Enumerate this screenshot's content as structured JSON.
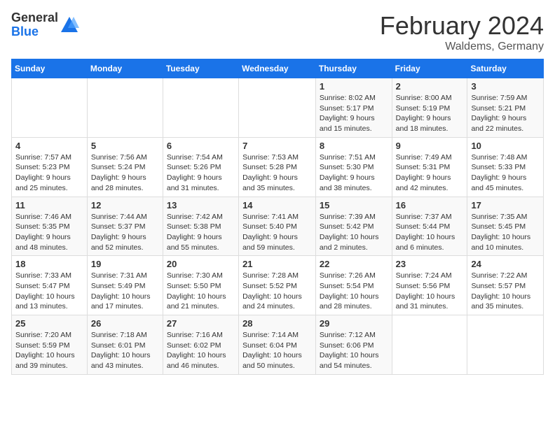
{
  "logo": {
    "general": "General",
    "blue": "Blue"
  },
  "header": {
    "month": "February 2024",
    "location": "Waldems, Germany"
  },
  "columns": [
    "Sunday",
    "Monday",
    "Tuesday",
    "Wednesday",
    "Thursday",
    "Friday",
    "Saturday"
  ],
  "weeks": [
    [
      {
        "day": "",
        "info": ""
      },
      {
        "day": "",
        "info": ""
      },
      {
        "day": "",
        "info": ""
      },
      {
        "day": "",
        "info": ""
      },
      {
        "day": "1",
        "sunrise": "Sunrise: 8:02 AM",
        "sunset": "Sunset: 5:17 PM",
        "daylight": "Daylight: 9 hours and 15 minutes."
      },
      {
        "day": "2",
        "sunrise": "Sunrise: 8:00 AM",
        "sunset": "Sunset: 5:19 PM",
        "daylight": "Daylight: 9 hours and 18 minutes."
      },
      {
        "day": "3",
        "sunrise": "Sunrise: 7:59 AM",
        "sunset": "Sunset: 5:21 PM",
        "daylight": "Daylight: 9 hours and 22 minutes."
      }
    ],
    [
      {
        "day": "4",
        "sunrise": "Sunrise: 7:57 AM",
        "sunset": "Sunset: 5:23 PM",
        "daylight": "Daylight: 9 hours and 25 minutes."
      },
      {
        "day": "5",
        "sunrise": "Sunrise: 7:56 AM",
        "sunset": "Sunset: 5:24 PM",
        "daylight": "Daylight: 9 hours and 28 minutes."
      },
      {
        "day": "6",
        "sunrise": "Sunrise: 7:54 AM",
        "sunset": "Sunset: 5:26 PM",
        "daylight": "Daylight: 9 hours and 31 minutes."
      },
      {
        "day": "7",
        "sunrise": "Sunrise: 7:53 AM",
        "sunset": "Sunset: 5:28 PM",
        "daylight": "Daylight: 9 hours and 35 minutes."
      },
      {
        "day": "8",
        "sunrise": "Sunrise: 7:51 AM",
        "sunset": "Sunset: 5:30 PM",
        "daylight": "Daylight: 9 hours and 38 minutes."
      },
      {
        "day": "9",
        "sunrise": "Sunrise: 7:49 AM",
        "sunset": "Sunset: 5:31 PM",
        "daylight": "Daylight: 9 hours and 42 minutes."
      },
      {
        "day": "10",
        "sunrise": "Sunrise: 7:48 AM",
        "sunset": "Sunset: 5:33 PM",
        "daylight": "Daylight: 9 hours and 45 minutes."
      }
    ],
    [
      {
        "day": "11",
        "sunrise": "Sunrise: 7:46 AM",
        "sunset": "Sunset: 5:35 PM",
        "daylight": "Daylight: 9 hours and 48 minutes."
      },
      {
        "day": "12",
        "sunrise": "Sunrise: 7:44 AM",
        "sunset": "Sunset: 5:37 PM",
        "daylight": "Daylight: 9 hours and 52 minutes."
      },
      {
        "day": "13",
        "sunrise": "Sunrise: 7:42 AM",
        "sunset": "Sunset: 5:38 PM",
        "daylight": "Daylight: 9 hours and 55 minutes."
      },
      {
        "day": "14",
        "sunrise": "Sunrise: 7:41 AM",
        "sunset": "Sunset: 5:40 PM",
        "daylight": "Daylight: 9 hours and 59 minutes."
      },
      {
        "day": "15",
        "sunrise": "Sunrise: 7:39 AM",
        "sunset": "Sunset: 5:42 PM",
        "daylight": "Daylight: 10 hours and 2 minutes."
      },
      {
        "day": "16",
        "sunrise": "Sunrise: 7:37 AM",
        "sunset": "Sunset: 5:44 PM",
        "daylight": "Daylight: 10 hours and 6 minutes."
      },
      {
        "day": "17",
        "sunrise": "Sunrise: 7:35 AM",
        "sunset": "Sunset: 5:45 PM",
        "daylight": "Daylight: 10 hours and 10 minutes."
      }
    ],
    [
      {
        "day": "18",
        "sunrise": "Sunrise: 7:33 AM",
        "sunset": "Sunset: 5:47 PM",
        "daylight": "Daylight: 10 hours and 13 minutes."
      },
      {
        "day": "19",
        "sunrise": "Sunrise: 7:31 AM",
        "sunset": "Sunset: 5:49 PM",
        "daylight": "Daylight: 10 hours and 17 minutes."
      },
      {
        "day": "20",
        "sunrise": "Sunrise: 7:30 AM",
        "sunset": "Sunset: 5:50 PM",
        "daylight": "Daylight: 10 hours and 21 minutes."
      },
      {
        "day": "21",
        "sunrise": "Sunrise: 7:28 AM",
        "sunset": "Sunset: 5:52 PM",
        "daylight": "Daylight: 10 hours and 24 minutes."
      },
      {
        "day": "22",
        "sunrise": "Sunrise: 7:26 AM",
        "sunset": "Sunset: 5:54 PM",
        "daylight": "Daylight: 10 hours and 28 minutes."
      },
      {
        "day": "23",
        "sunrise": "Sunrise: 7:24 AM",
        "sunset": "Sunset: 5:56 PM",
        "daylight": "Daylight: 10 hours and 31 minutes."
      },
      {
        "day": "24",
        "sunrise": "Sunrise: 7:22 AM",
        "sunset": "Sunset: 5:57 PM",
        "daylight": "Daylight: 10 hours and 35 minutes."
      }
    ],
    [
      {
        "day": "25",
        "sunrise": "Sunrise: 7:20 AM",
        "sunset": "Sunset: 5:59 PM",
        "daylight": "Daylight: 10 hours and 39 minutes."
      },
      {
        "day": "26",
        "sunrise": "Sunrise: 7:18 AM",
        "sunset": "Sunset: 6:01 PM",
        "daylight": "Daylight: 10 hours and 43 minutes."
      },
      {
        "day": "27",
        "sunrise": "Sunrise: 7:16 AM",
        "sunset": "Sunset: 6:02 PM",
        "daylight": "Daylight: 10 hours and 46 minutes."
      },
      {
        "day": "28",
        "sunrise": "Sunrise: 7:14 AM",
        "sunset": "Sunset: 6:04 PM",
        "daylight": "Daylight: 10 hours and 50 minutes."
      },
      {
        "day": "29",
        "sunrise": "Sunrise: 7:12 AM",
        "sunset": "Sunset: 6:06 PM",
        "daylight": "Daylight: 10 hours and 54 minutes."
      },
      {
        "day": "",
        "info": ""
      },
      {
        "day": "",
        "info": ""
      }
    ]
  ]
}
